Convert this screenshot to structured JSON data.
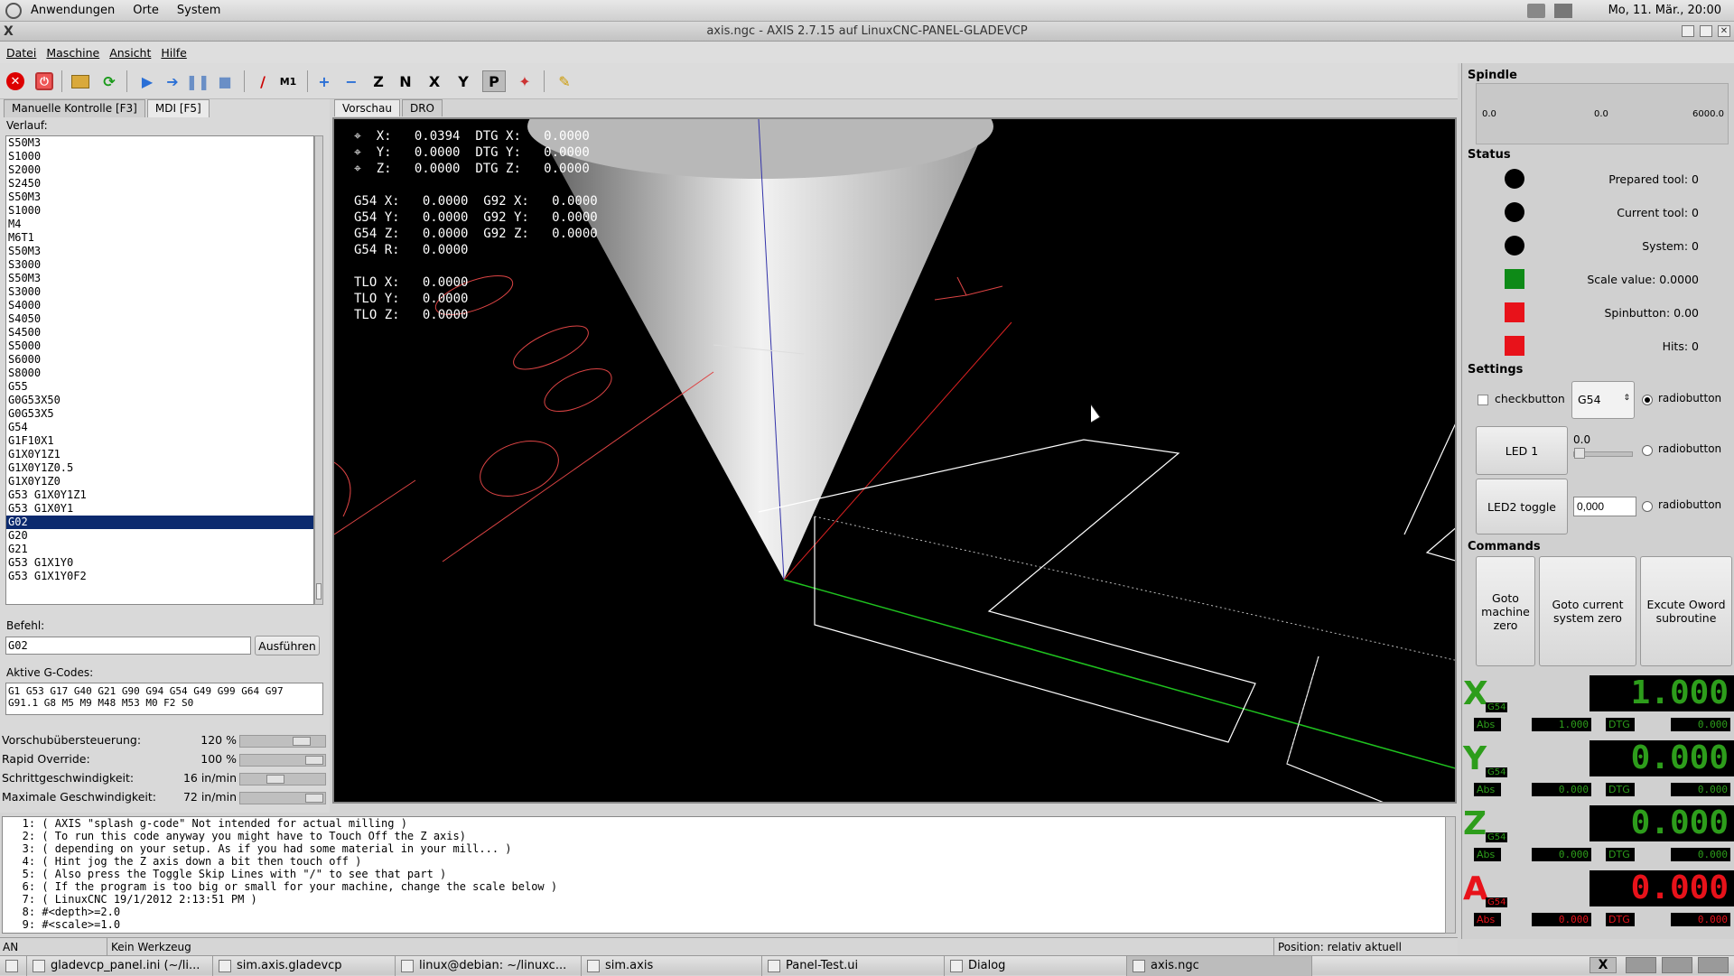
{
  "topbar": {
    "menu": [
      "Anwendungen",
      "Orte",
      "System"
    ],
    "clock": "Mo, 11. Mär., 20:00"
  },
  "title": "axis.ngc - AXIS 2.7.15 auf  LinuxCNC-PANEL-GLADEVCP",
  "menubar": [
    "Datei",
    "Maschine",
    "Ansicht",
    "Hilfe"
  ],
  "toolbar_letters": [
    "Z",
    "N",
    "X",
    "Y",
    "P"
  ],
  "left_tabs": [
    "Manuelle Kontrolle [F3]",
    "MDI [F5]"
  ],
  "history_label": "Verlauf:",
  "history": [
    "S50M3",
    "S1000",
    "S2000",
    "S2450",
    "S50M3",
    "S1000",
    "M4",
    "M6T1",
    "S50M3",
    "S3000",
    "S50M3",
    "S3000",
    "S4000",
    "S4050",
    "S4500",
    "S5000",
    "S6000",
    "S8000",
    "G55",
    "G0G53X50",
    "G0G53X5",
    "G54",
    "G1F10X1",
    "G1X0Y1Z1",
    "G1X0Y1Z0.5",
    "G1X0Y1Z0",
    "G53 G1X0Y1Z1",
    "G53 G1X0Y1",
    "G02",
    "G20",
    "G21",
    "G53 G1X1Y0",
    "G53 G1X1Y0F2"
  ],
  "history_selected": 28,
  "command_label": "Befehl:",
  "command_value": "G02",
  "run_label": "Ausführen",
  "active_gcodes_label": "Aktive G-Codes:",
  "active_gcodes_line1": "G1 G53 G17 G40 G21 G90 G94 G54 G49 G99 G64 G97",
  "active_gcodes_line2": "G91.1 G8 M5 M9 M48 M53 M0 F2 S0",
  "overrides": [
    {
      "label": "Vorschubübersteuerung:",
      "value": "120 %",
      "level": 0.8
    },
    {
      "label": "Rapid Override:",
      "value": "100 %",
      "level": 1.0
    },
    {
      "label": "Schrittgeschwindigkeit:",
      "value": "16 in/min",
      "level": 0.4
    },
    {
      "label": "Maximale Geschwindigkeit:",
      "value": "72 in/min",
      "level": 1.0
    }
  ],
  "preview_tabs": [
    "Vorschau",
    "DRO"
  ],
  "dro_text": "⌖  X:   0.0394  DTG X:   0.0000\n⌖  Y:   0.0000  DTG Y:   0.0000\n⌖  Z:   0.0000  DTG Z:   0.0000\n\nG54 X:   0.0000  G92 X:   0.0000\nG54 Y:   0.0000  G92 Y:   0.0000\nG54 Z:   0.0000  G92 Z:   0.0000\nG54 R:   0.0000\n\nTLO X:   0.0000\nTLO Y:   0.0000\nTLO Z:   0.0000",
  "gcode_lines": [
    "   1: ( AXIS \"splash g-code\" Not intended for actual milling )",
    "   2: ( To run this code anyway you might have to Touch Off the Z axis)",
    "   3: ( depending on your setup. As if you had some material in your mill... )",
    "   4: ( Hint jog the Z axis down a bit then touch off )",
    "   5: ( Also press the Toggle Skip Lines with \"/\" to see that part )",
    "   6: ( If the program is too big or small for your machine, change the scale below )",
    "   7: ( LinuxCNC 19/1/2012 2:13:51 PM )",
    "   8: #<depth>=2.0",
    "   9: #<scale>=1.0"
  ],
  "statusbar": {
    "state": "AN",
    "tool": "Kein Werkzeug",
    "position": "Position: relativ aktuell"
  },
  "right": {
    "spindle_label": "Spindle",
    "spindle_min": "0.0",
    "spindle_mid": "0.0",
    "spindle_max": "6000.0",
    "status_label": "Status",
    "status": [
      {
        "label": "Prepared tool: 0",
        "shape": "dot",
        "color": "#000000"
      },
      {
        "label": "Current tool: 0",
        "shape": "dot",
        "color": "#000000"
      },
      {
        "label": "System: 0",
        "shape": "dot",
        "color": "#000000"
      },
      {
        "label": "Scale value: 0.0000",
        "shape": "sq",
        "color": "#0e8a17"
      },
      {
        "label": "Spinbutton: 0.00",
        "shape": "sq",
        "color": "#e8121a"
      },
      {
        "label": "Hits: 0",
        "shape": "sq",
        "color": "#e8121a"
      }
    ],
    "settings_label": "Settings",
    "checkbutton": "checkbutton",
    "combo_value": "G54",
    "radio": "radiobutton",
    "led1": "LED 1",
    "led2": "LED2 toggle",
    "hscale_value": "0.0",
    "spin_value": "0,000",
    "commands_label": "Commands",
    "cmd1": "Goto machine zero",
    "cmd2": "Goto current system zero",
    "cmd3": "Excute Oword subroutine",
    "axes": [
      {
        "letter": "X",
        "sys": "G54",
        "value": "1.000",
        "abs": "1.000",
        "dtg": "0.000",
        "color": "#2d9d1b"
      },
      {
        "letter": "Y",
        "sys": "G54",
        "value": "0.000",
        "abs": "0.000",
        "dtg": "0.000",
        "color": "#2d9d1b"
      },
      {
        "letter": "Z",
        "sys": "G54",
        "value": "0.000",
        "abs": "0.000",
        "dtg": "0.000",
        "color": "#2d9d1b"
      },
      {
        "letter": "A",
        "sys": "G54",
        "value": "0.000",
        "abs": "0.000",
        "dtg": "0.000",
        "color": "#e8121a"
      }
    ],
    "abs_label": "Abs",
    "dtg_label": "DTG"
  },
  "taskbar": [
    "gladevcp_panel.ini (~/li...",
    "sim.axis.gladevcp",
    "linux@debian: ~/linuxc...",
    "sim.axis",
    "Panel-Test.ui",
    "Dialog",
    "axis.ngc"
  ]
}
